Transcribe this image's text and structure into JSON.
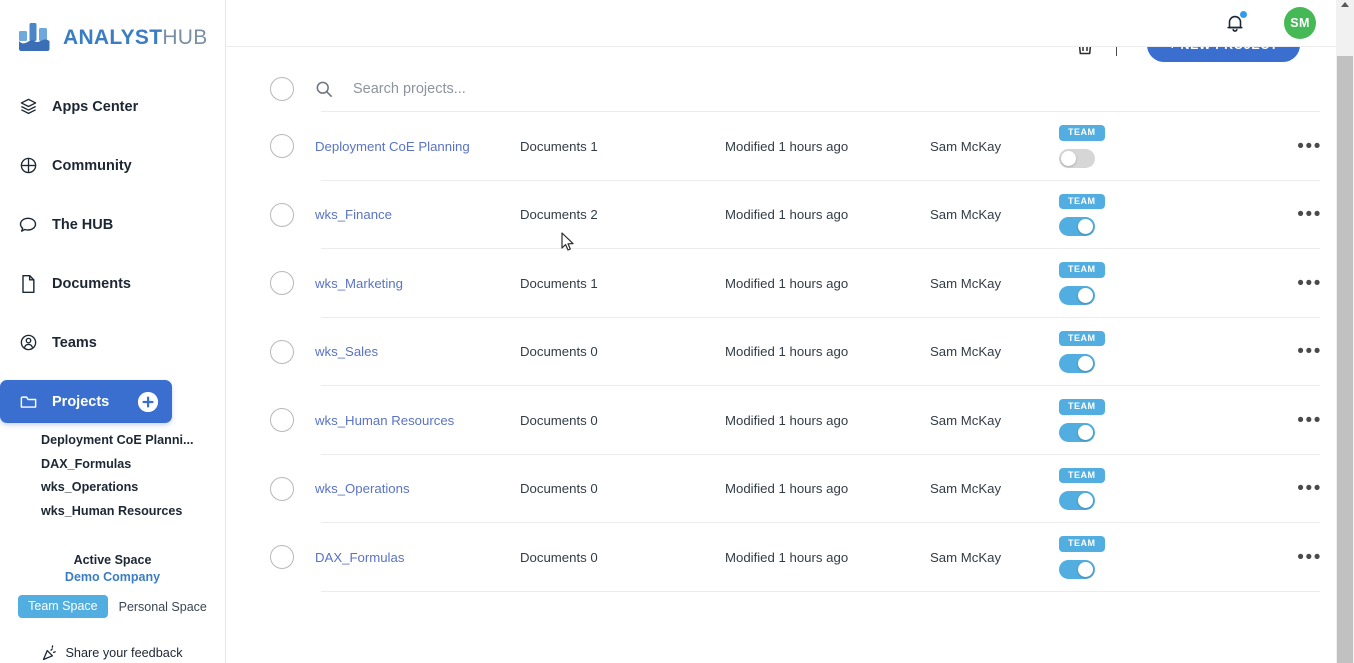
{
  "brand": {
    "name_bold": "ANALYST",
    "name_light": "HUB",
    "logo_icon": "bar-chart-wave-logo",
    "primary_color": "#3a6fd0",
    "accent_color": "#52aee0",
    "link_color": "#5a73c4"
  },
  "sidebar": {
    "items": [
      {
        "label": "Apps Center",
        "icon": "layers-icon"
      },
      {
        "label": "Community",
        "icon": "globe-icon"
      },
      {
        "label": "The HUB",
        "icon": "chat-bubble-icon"
      },
      {
        "label": "Documents",
        "icon": "document-icon"
      },
      {
        "label": "Teams",
        "icon": "teams-user-circle-icon"
      },
      {
        "label": "Projects",
        "icon": "folder-icon",
        "active": true,
        "action_icon": "plus-circle-icon"
      }
    ],
    "project_sublist": [
      "Deployment CoE Planni...",
      "DAX_Formulas",
      "wks_Operations",
      "wks_Human Resources"
    ],
    "space": {
      "title": "Active Space",
      "name": "Demo Company",
      "team_space_label": "Team Space",
      "personal_space_label": "Personal Space",
      "selected": "Team Space"
    },
    "feedback": {
      "label": "Share your feedback",
      "icon": "party-popper-icon"
    }
  },
  "topbar": {
    "bell_icon": "notification-bell-icon",
    "has_notification": true,
    "avatar_initials": "SM",
    "avatar_color": "#46b957",
    "trash_icon": "trash-icon",
    "new_project_label": "+ NEW PROJECT"
  },
  "search": {
    "placeholder": "Search projects...",
    "value": "",
    "icon": "search-icon"
  },
  "table": {
    "rows": [
      {
        "name": "Deployment CoE Planning",
        "documents": "Documents 1",
        "modified": "Modified 1 hours ago",
        "owner": "Sam McKay",
        "badge": "TEAM",
        "shared": false,
        "more": "•••"
      },
      {
        "name": "wks_Finance",
        "documents": "Documents 2",
        "modified": "Modified 1 hours ago",
        "owner": "Sam McKay",
        "badge": "TEAM",
        "shared": true,
        "more": "•••"
      },
      {
        "name": "wks_Marketing",
        "documents": "Documents 1",
        "modified": "Modified 1 hours ago",
        "owner": "Sam McKay",
        "badge": "TEAM",
        "shared": true,
        "more": "•••"
      },
      {
        "name": "wks_Sales",
        "documents": "Documents 0",
        "modified": "Modified 1 hours ago",
        "owner": "Sam McKay",
        "badge": "TEAM",
        "shared": true,
        "more": "•••"
      },
      {
        "name": "wks_Human Resources",
        "documents": "Documents 0",
        "modified": "Modified 1 hours ago",
        "owner": "Sam McKay",
        "badge": "TEAM",
        "shared": true,
        "more": "•••"
      },
      {
        "name": "wks_Operations",
        "documents": "Documents 0",
        "modified": "Modified 1 hours ago",
        "owner": "Sam McKay",
        "badge": "TEAM",
        "shared": true,
        "more": "•••"
      },
      {
        "name": "DAX_Formulas",
        "documents": "Documents 0",
        "modified": "Modified 1 hours ago",
        "owner": "Sam McKay",
        "badge": "TEAM",
        "shared": true,
        "more": "•••"
      }
    ]
  },
  "scrollbar": {
    "orientation": "vertical",
    "arrow_up_icon": "triangle-up-icon"
  }
}
